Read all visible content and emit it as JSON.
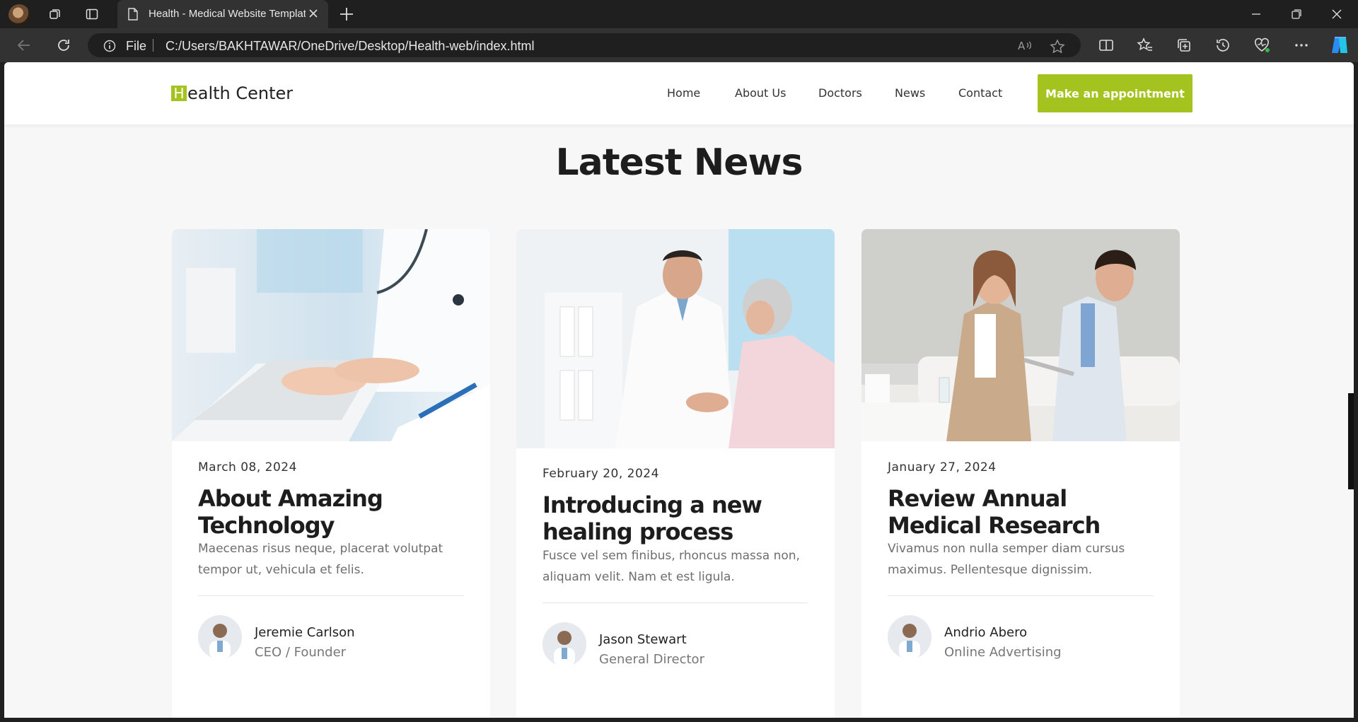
{
  "browser": {
    "tab_title": "Health - Medical Website Template",
    "address_scheme": "File",
    "address": "C:/Users/BAKHTAWAR/OneDrive/Desktop/Health-web/index.html"
  },
  "header": {
    "logo_initial": "H",
    "logo_rest": "ealth Center",
    "nav": [
      "Home",
      "About Us",
      "Doctors",
      "News",
      "Contact"
    ],
    "cta_label": "Make an appointment"
  },
  "section": {
    "title": "Latest News"
  },
  "articles": [
    {
      "date": "March 08, 2024",
      "title": "About Amazing Technology",
      "excerpt": "Maecenas risus neque, placerat volutpat tempor ut, vehicula et felis.",
      "author": "Jeremie Carlson",
      "role": "CEO / Founder"
    },
    {
      "date": "February 20, 2024",
      "title": "Introducing a new healing process",
      "excerpt": "Fusce vel sem finibus, rhoncus massa non, aliquam velit. Nam et est ligula.",
      "author": "Jason Stewart",
      "role": "General Director"
    },
    {
      "date": "January 27, 2024",
      "title": "Review Annual Medical Research",
      "excerpt": "Vivamus non nulla semper diam cursus maximus. Pellentesque dignissim.",
      "author": "Andrio Abero",
      "role": "Online Advertising"
    }
  ],
  "colors": {
    "accent": "#a4c31f",
    "page_bg": "#f7f7f7",
    "chrome_bg": "#1f1f1f"
  }
}
